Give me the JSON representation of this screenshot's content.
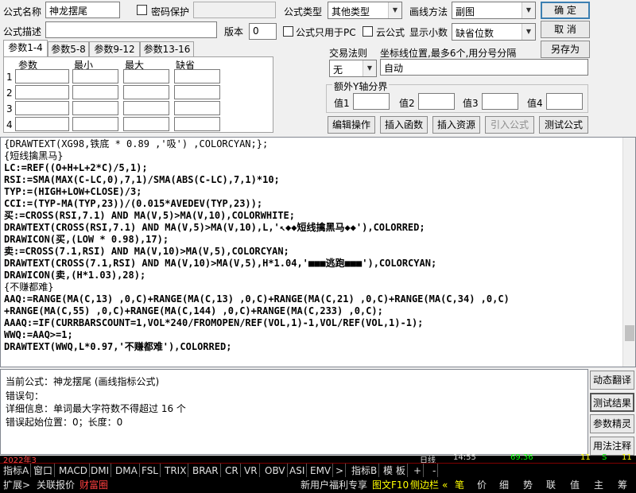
{
  "top": {
    "name_label": "公式名称",
    "name_value": "神龙摆尾",
    "password_label": "密码保护",
    "type_label": "公式类型",
    "type_value": "其他类型",
    "draw_label": "画线方法",
    "draw_value": "副图",
    "ok": "确  定",
    "desc_label": "公式描述",
    "desc_value": "",
    "version_label": "版本",
    "version_value": "0",
    "pc_only_label": "公式只用于PC",
    "cloud_label": "云公式",
    "decimals_label": "显示小数",
    "decimals_value": "缺省位数",
    "cancel": "取  消",
    "save_as": "另存为"
  },
  "tabs": [
    "参数1-4",
    "参数5-8",
    "参数9-12",
    "参数13-16"
  ],
  "params": {
    "headers": [
      "参数",
      "最小",
      "最大",
      "缺省"
    ],
    "rows": [
      "1",
      "2",
      "3",
      "4"
    ]
  },
  "trade": {
    "rule_label": "交易法则",
    "rule_value": "无",
    "coord_label": "坐标线位置,最多6个,用分号分隔",
    "coord_value": "自动",
    "yaxis_label": "额外Y轴分界",
    "values": [
      "值1",
      "值2",
      "值3",
      "值4"
    ]
  },
  "actions": [
    "编辑操作",
    "插入函数",
    "插入资源",
    "引入公式",
    "测试公式"
  ],
  "code_lines": [
    "{DRAWTEXT(XG98,铁底 * 0.89 ,'吸') ,COLORCYAN;};",
    "{短线擒黑马}",
    "LC:=REF((O+H+L+2*C)/5,1);",
    "RSI:=SMA(MAX(C-LC,0),7,1)/SMA(ABS(C-LC),7,1)*10;",
    "TYP:=(HIGH+LOW+CLOSE)/3;",
    "CCI:=(TYP-MA(TYP,23))/(0.015*AVEDEV(TYP,23));",
    "买:=CROSS(RSI,7.1) AND MA(V,5)>MA(V,10),COLORWHITE;",
    "DRAWTEXT(CROSS(RSI,7.1) AND MA(V,5)>MA(V,10),L,'↖◆◆短线擒黑马◆◆'),COLORRED;",
    "DRAWICON(买,(LOW * 0.98),17);",
    "卖:=CROSS(7.1,RSI) AND MA(V,10)>MA(V,5),COLORCYAN;",
    "DRAWTEXT(CROSS(7.1,RSI) AND MA(V,10)>MA(V,5),H*1.04,'■■■逃跑■■■'),COLORCYAN;",
    "DRAWICON(卖,(H*1.03),28);",
    "{不赚都难}",
    "AAQ:=RANGE(MA(C,13) ,0,C)+RANGE(MA(C,13) ,0,C)+RANGE(MA(C,21) ,0,C)+RANGE(MA(C,34) ,0,C)",
    "+RANGE(MA(C,55) ,0,C)+RANGE(MA(C,144) ,0,C)+RANGE(MA(C,233) ,0,C);",
    "AAAQ:=IF(CURRBARSCOUNT=1,VOL*240/FROMOPEN/REF(VOL,1)-1,VOL/REF(VOL,1)-1);",
    "WWQ:=AAQ>=1;",
    "DRAWTEXT(WWQ,L*0.97,'不赚都难'),COLORRED;"
  ],
  "messages": {
    "current": "当前公式：神龙摆尾 (画线指标公式)",
    "error": "错误句：",
    "detail": "详细信息：单词最大字符数不得超过 16 个",
    "pos": "错误起始位置：0；长度：0"
  },
  "side_buttons": [
    "动态翻译",
    "测试结果",
    "参数精灵",
    "用法注释"
  ],
  "bottom_bar1": [
    "指标A",
    "窗口",
    "MACD",
    "DMI",
    "DMA",
    "FSL",
    "TRIX",
    "BRAR",
    "CR",
    "VR",
    "OBV",
    "ASI",
    "EMV",
    ">",
    "指标B",
    "模 板",
    "+",
    "-"
  ],
  "bottom_bar2": [
    "扩展>",
    "关联报价",
    "财富圈",
    "新用户福利专享",
    "图文F10",
    "侧边栏",
    "«",
    "笔",
    "价",
    "细",
    "势",
    "联",
    "值",
    "主",
    "筹"
  ],
  "ticker": {
    "time": "14:55",
    "price": "69.36",
    "t1": "11",
    "t2": "S",
    "t3": "11",
    "date": "2022年3",
    "label": "日线"
  }
}
